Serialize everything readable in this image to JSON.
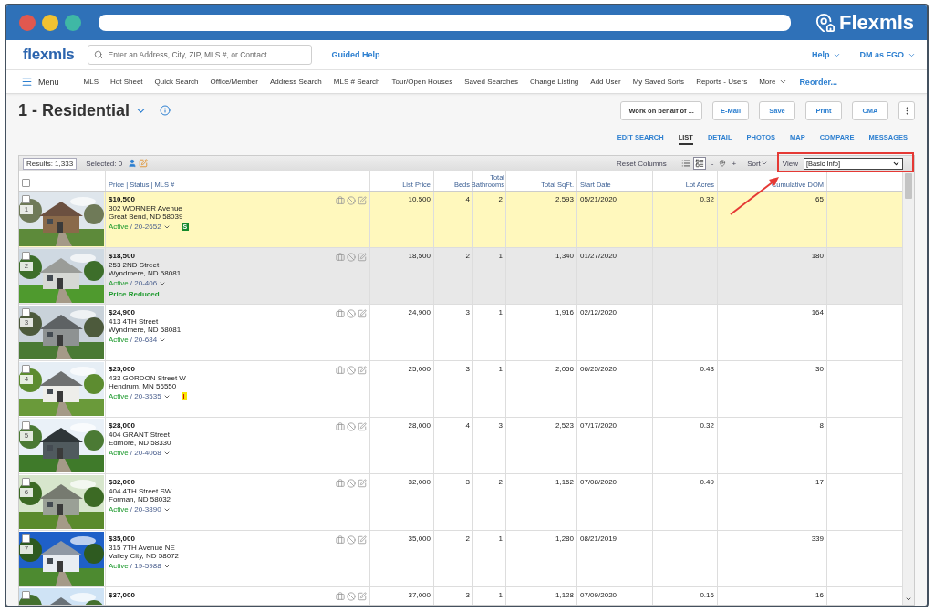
{
  "browser": {
    "logo": "Flexmls"
  },
  "header": {
    "logo": "flexmls",
    "search": {
      "placeholder": "Enter an Address, City, ZIP, MLS #, or Contact..."
    },
    "guided_help": "Guided Help",
    "help": "Help",
    "user": "DM as FGO"
  },
  "nav": {
    "menu": "Menu",
    "items": [
      "MLS",
      "Hot Sheet",
      "Quick Search",
      "Office/Member",
      "Address Search",
      "MLS # Search",
      "Tour/Open Houses",
      "Saved Searches",
      "Change Listing",
      "Add User",
      "My Saved Sorts",
      "Reports - Users"
    ],
    "more": "More",
    "reorder": "Reorder..."
  },
  "page": {
    "title": "1 - Residential",
    "actions": [
      "Work on behalf of ...",
      "E-Mail",
      "Save",
      "Print",
      "CMA"
    ]
  },
  "tabs": [
    {
      "label": "EDIT SEARCH",
      "selected": false
    },
    {
      "label": "LIST",
      "selected": true
    },
    {
      "label": "DETAIL",
      "selected": false
    },
    {
      "label": "PHOTOS",
      "selected": false
    },
    {
      "label": "MAP",
      "selected": false
    },
    {
      "label": "COMPARE",
      "selected": false
    },
    {
      "label": "MESSAGES",
      "selected": false
    }
  ],
  "toolbar": {
    "results": "Results: 1,333",
    "selected": "Selected: 0",
    "reset": "Reset Columns",
    "minus": "-",
    "plus": "+",
    "sort": "Sort",
    "view_label": "View",
    "view_value": "[Basic Info]"
  },
  "table": {
    "select_all": {
      "checked": false
    },
    "listing_column": "Price | Status | MLS #",
    "columns": [
      "List Price",
      "Beds",
      "Total Bathrooms",
      "Total SqFt.",
      "Start Date",
      "Lot Acres",
      "Cumulative DOM"
    ],
    "rows": [
      {
        "number": "1",
        "price": "$10,500",
        "street": "302 WORNER Avenue",
        "city": "Great Bend, ND 58039",
        "status": "Active",
        "mls": "/ 20-2652",
        "badge": {
          "text": "S",
          "color": "#168a2c"
        },
        "selected": true,
        "hovered": false,
        "checked": false,
        "cells": [
          "10,500",
          "4",
          "2",
          "2,593",
          "05/21/2020",
          "0.32",
          "65"
        ]
      },
      {
        "number": "2",
        "price": "$18,500",
        "street": "253 2ND Street",
        "city": "Wyndmere, ND 58081",
        "status": "Active",
        "mls": "/ 20-406",
        "note": "Price Reduced",
        "selected": false,
        "hovered": true,
        "checked": false,
        "cells": [
          "18,500",
          "2",
          "1",
          "1,340",
          "01/27/2020",
          "",
          "180"
        ]
      },
      {
        "number": "3",
        "price": "$24,900",
        "street": "413 4TH Street",
        "city": "Wyndmere, ND 58081",
        "status": "Active",
        "mls": "/ 20-684",
        "selected": false,
        "hovered": false,
        "checked": false,
        "cells": [
          "24,900",
          "3",
          "1",
          "1,916",
          "02/12/2020",
          "",
          "164"
        ]
      },
      {
        "number": "4",
        "price": "$25,000",
        "street": "433 GORDON Street W",
        "city": "Hendrum, MN 56550",
        "status": "Active",
        "mls": "/ 20-3535",
        "badge": {
          "text": "I",
          "color": "#f7e600"
        },
        "selected": false,
        "hovered": false,
        "checked": false,
        "cells": [
          "25,000",
          "3",
          "1",
          "2,056",
          "06/25/2020",
          "0.43",
          "30"
        ]
      },
      {
        "number": "5",
        "price": "$28,000",
        "street": "404 GRANT Street",
        "city": "Edmore, ND 58330",
        "status": "Active",
        "mls": "/ 20-4068",
        "selected": false,
        "hovered": false,
        "checked": false,
        "cells": [
          "28,000",
          "4",
          "3",
          "2,523",
          "07/17/2020",
          "0.32",
          "8"
        ]
      },
      {
        "number": "6",
        "price": "$32,000",
        "street": "404 4TH Street SW",
        "city": "Forman, ND 58032",
        "status": "Active",
        "mls": "/ 20-3890",
        "selected": false,
        "hovered": false,
        "checked": false,
        "cells": [
          "32,000",
          "3",
          "2",
          "1,152",
          "07/08/2020",
          "0.49",
          "17"
        ]
      },
      {
        "number": "7",
        "price": "$35,000",
        "street": "315 7TH Avenue NE",
        "city": "Valley City, ND 58072",
        "status": "Active",
        "mls": "/ 19-5988",
        "selected": false,
        "hovered": false,
        "checked": false,
        "cells": [
          "35,000",
          "2",
          "1",
          "1,280",
          "08/21/2019",
          "",
          "339"
        ]
      },
      {
        "price": "$37,000",
        "selected": false,
        "hovered": false,
        "checked": false,
        "cells": [
          "37,000",
          "3",
          "1",
          "1,128",
          "07/09/2020",
          "0.16",
          "16"
        ]
      }
    ]
  }
}
